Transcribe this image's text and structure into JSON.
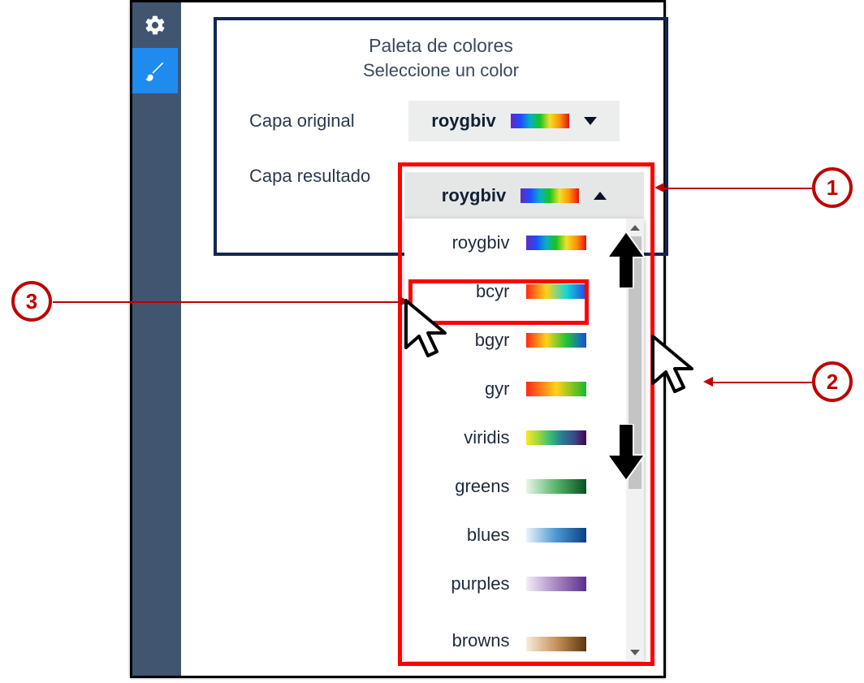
{
  "palette": {
    "title": "Paleta de colores",
    "subtitle": "Seleccione un color",
    "original_label": "Capa original",
    "result_label": "Capa resultado",
    "selected_original": "roygbiv",
    "selected_result": "roygbiv"
  },
  "dropdown": {
    "options": [
      {
        "label": "roygbiv",
        "grad": "grad-roygbiv"
      },
      {
        "label": "bcyr",
        "grad": "grad-bcyr"
      },
      {
        "label": "bgyr",
        "grad": "grad-bgyr"
      },
      {
        "label": "gyr",
        "grad": "grad-gyr"
      },
      {
        "label": "viridis",
        "grad": "grad-viridis"
      },
      {
        "label": "greens",
        "grad": "grad-greens"
      },
      {
        "label": "blues",
        "grad": "grad-blues"
      },
      {
        "label": "purples",
        "grad": "grad-purples"
      },
      {
        "label": "browns",
        "grad": "grad-browns"
      }
    ]
  },
  "callouts": {
    "num1": "1",
    "num2": "2",
    "num3": "3"
  }
}
